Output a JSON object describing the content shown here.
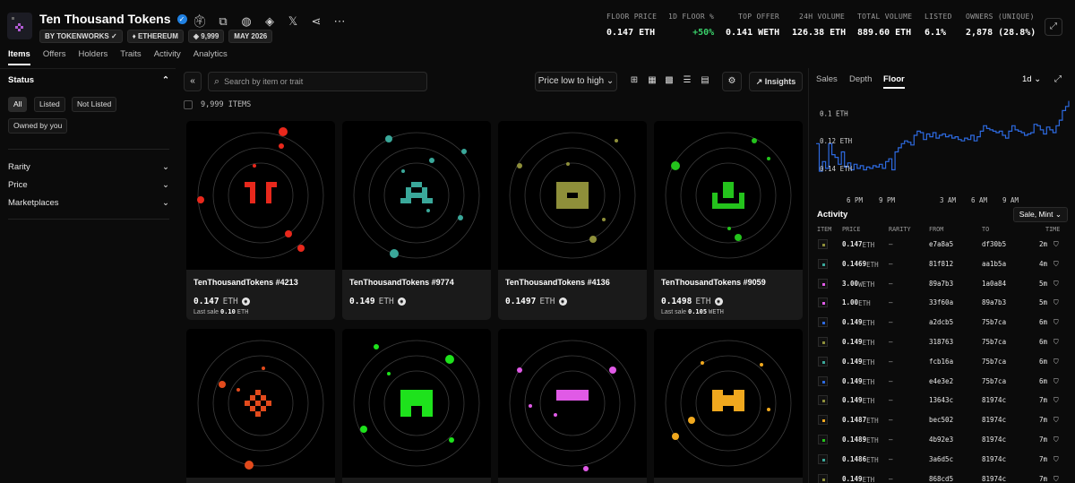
{
  "collection": {
    "title": "Ten Thousand Tokens",
    "chips": [
      "BY TOKENWORKS",
      "ETHEREUM",
      "9,999",
      "MAY 2026"
    ]
  },
  "stats": [
    {
      "label": "FLOOR PRICE",
      "value": "0.147 ETH"
    },
    {
      "label": "1D FLOOR %",
      "value": "+50%",
      "color": "#3ad16b"
    },
    {
      "label": "TOP OFFER",
      "value": "0.141 WETH"
    },
    {
      "label": "24H VOLUME",
      "value": "126.38 ETH"
    },
    {
      "label": "TOTAL VOLUME",
      "value": "889.60 ETH"
    },
    {
      "label": "LISTED",
      "value": "6.1%"
    },
    {
      "label": "OWNERS (UNIQUE)",
      "value": "2,878 (28.8%)"
    }
  ],
  "tabs": [
    "Items",
    "Offers",
    "Holders",
    "Traits",
    "Activity",
    "Analytics"
  ],
  "sidebar": {
    "status_label": "Status",
    "status_pills": [
      "All",
      "Listed",
      "Not Listed",
      "Owned by you"
    ],
    "filters": [
      "Rarity",
      "Price",
      "Marketplaces"
    ]
  },
  "toolbar": {
    "search_placeholder": "Search by item or trait",
    "sort_label": "Price low to high",
    "insights_label": "Insights",
    "item_count": "9,999 ITEMS"
  },
  "cards": [
    {
      "name": "TenThousandTokens #4213",
      "price": "0.147",
      "currency": "ETH",
      "last_label": "Last sale",
      "last_value": "0.10",
      "last_currency": "ETH",
      "color": "#e8281c",
      "glyph": "pillars"
    },
    {
      "name": "TenThousandTokens #9774",
      "price": "0.149",
      "currency": "ETH",
      "last_label": "",
      "last_value": "",
      "last_currency": "",
      "color": "#3aa89a",
      "glyph": "robot"
    },
    {
      "name": "TenThousandTokens #4136",
      "price": "0.1497",
      "currency": "ETH",
      "last_label": "",
      "last_value": "",
      "last_currency": "",
      "color": "#8e8f3a",
      "glyph": "box"
    },
    {
      "name": "TenThousandTokens #9059",
      "price": "0.1498",
      "currency": "ETH",
      "last_label": "Last sale",
      "last_value": "0.105",
      "last_currency": "WETH",
      "color": "#24c31c",
      "glyph": "cup"
    },
    {
      "name": "",
      "price": "",
      "currency": "",
      "last_label": "",
      "last_value": "",
      "last_currency": "",
      "color": "#e24a1c",
      "glyph": "checker"
    },
    {
      "name": "",
      "price": "",
      "currency": "",
      "last_label": "",
      "last_value": "",
      "last_currency": "",
      "color": "#1ee21c",
      "glyph": "arch"
    },
    {
      "name": "",
      "price": "",
      "currency": "",
      "last_label": "",
      "last_value": "",
      "last_currency": "",
      "color": "#e05ae6",
      "glyph": "bar"
    },
    {
      "name": "",
      "price": "",
      "currency": "",
      "last_label": "",
      "last_value": "",
      "last_currency": "",
      "color": "#f0a81e",
      "glyph": "bowtie"
    }
  ],
  "right_panel": {
    "tabs": [
      "Sales",
      "Depth",
      "Floor"
    ],
    "interval": "1d",
    "y_ticks": [
      "0.14 ETH",
      "0.12 ETH",
      "0.1 ETH"
    ],
    "x_ticks": [
      "6 PM",
      "9 PM",
      "3 AM",
      "6 AM",
      "9 AM"
    ],
    "activity_title": "Activity",
    "activity_filter": "Sale, Mint",
    "columns": [
      "ITEM",
      "PRICE",
      "RARITY",
      "FROM",
      "TO",
      "TIME"
    ],
    "rows": [
      {
        "price": "0.147",
        "cur": "ETH",
        "rarity": "—",
        "from": "e7a8a5",
        "to": "df30b5",
        "time": "2m",
        "c": "#8e8f3a"
      },
      {
        "price": "0.1469",
        "cur": "ETH",
        "rarity": "—",
        "from": "81f812",
        "to": "aa1b5a",
        "time": "4m",
        "c": "#3aa89a"
      },
      {
        "price": "3.00",
        "cur": "WETH",
        "rarity": "—",
        "from": "89a7b3",
        "to": "1a0a84",
        "time": "5m",
        "c": "#e05ae6"
      },
      {
        "price": "1.00",
        "cur": "ETH",
        "rarity": "—",
        "from": "33f60a",
        "to": "89a7b3",
        "time": "5m",
        "c": "#e05ae6"
      },
      {
        "price": "0.149",
        "cur": "ETH",
        "rarity": "—",
        "from": "a2dcb5",
        "to": "75b7ca",
        "time": "6m",
        "c": "#2d6ae0"
      },
      {
        "price": "0.149",
        "cur": "ETH",
        "rarity": "—",
        "from": "318763",
        "to": "75b7ca",
        "time": "6m",
        "c": "#8e8f3a"
      },
      {
        "price": "0.149",
        "cur": "ETH",
        "rarity": "—",
        "from": "fcb16a",
        "to": "75b7ca",
        "time": "6m",
        "c": "#3aa89a"
      },
      {
        "price": "0.149",
        "cur": "ETH",
        "rarity": "—",
        "from": "e4e3e2",
        "to": "75b7ca",
        "time": "6m",
        "c": "#2d6ae0"
      },
      {
        "price": "0.149",
        "cur": "ETH",
        "rarity": "—",
        "from": "13643c",
        "to": "81974c",
        "time": "7m",
        "c": "#8e8f3a"
      },
      {
        "price": "0.1487",
        "cur": "ETH",
        "rarity": "—",
        "from": "bec502",
        "to": "81974c",
        "time": "7m",
        "c": "#f0a81e"
      },
      {
        "price": "0.1489",
        "cur": "ETH",
        "rarity": "—",
        "from": "4b92e3",
        "to": "81974c",
        "time": "7m",
        "c": "#24c31c"
      },
      {
        "price": "0.1486",
        "cur": "ETH",
        "rarity": "—",
        "from": "3a6d5c",
        "to": "81974c",
        "time": "7m",
        "c": "#3aa89a"
      },
      {
        "price": "0.149",
        "cur": "ETH",
        "rarity": "—",
        "from": "868cd5",
        "to": "81974c",
        "time": "7m",
        "c": "#8e8f3a"
      }
    ]
  },
  "chart_data": {
    "type": "line",
    "title": "",
    "ylim": [
      0.085,
      0.152
    ],
    "y_ticks": [
      0.1,
      0.12,
      0.14
    ],
    "x": [
      0,
      1,
      2,
      3,
      4,
      5,
      6,
      7,
      8,
      9,
      10,
      11,
      12,
      13,
      14,
      15,
      16,
      17,
      18,
      19,
      20,
      21,
      22,
      23,
      24,
      25,
      26,
      27,
      28,
      29,
      30,
      31,
      32,
      33,
      34,
      35,
      36,
      37,
      38,
      39,
      40,
      41,
      42,
      43,
      44,
      45,
      46,
      47,
      48,
      49,
      50,
      51,
      52,
      53,
      54,
      55,
      56,
      57,
      58,
      59,
      60,
      61,
      62,
      63,
      64,
      65,
      66,
      67,
      68,
      69,
      70,
      71,
      72,
      73,
      74,
      75,
      76,
      77,
      78,
      79,
      80
    ],
    "values": [
      0.118,
      0.098,
      0.105,
      0.1,
      0.118,
      0.11,
      0.108,
      0.103,
      0.112,
      0.101,
      0.104,
      0.099,
      0.103,
      0.1,
      0.102,
      0.099,
      0.101,
      0.1,
      0.102,
      0.101,
      0.103,
      0.1,
      0.105,
      0.107,
      0.099,
      0.112,
      0.115,
      0.118,
      0.12,
      0.119,
      0.117,
      0.124,
      0.127,
      0.126,
      0.121,
      0.125,
      0.123,
      0.126,
      0.122,
      0.124,
      0.125,
      0.123,
      0.124,
      0.122,
      0.123,
      0.121,
      0.12,
      0.122,
      0.121,
      0.124,
      0.12,
      0.123,
      0.127,
      0.131,
      0.129,
      0.128,
      0.127,
      0.126,
      0.127,
      0.124,
      0.122,
      0.127,
      0.131,
      0.128,
      0.127,
      0.126,
      0.124,
      0.125,
      0.126,
      0.132,
      0.131,
      0.128,
      0.125,
      0.13,
      0.128,
      0.126,
      0.131,
      0.135,
      0.142,
      0.145,
      0.149
    ],
    "color": "#2d6ae0"
  }
}
